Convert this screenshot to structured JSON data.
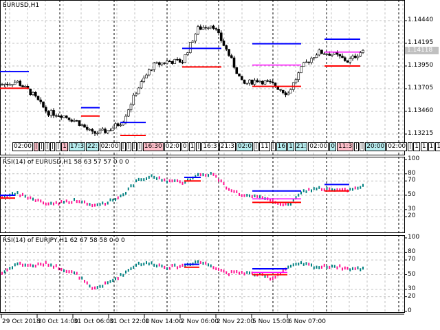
{
  "window": {
    "title": "EURUSD,H1"
  },
  "price_scale": {
    "ticks": [
      "1.14440",
      "1.14195",
      "1.13950",
      "1.13705",
      "1.13460",
      "1.13215"
    ],
    "tick_values": [
      1.1444,
      1.14195,
      1.1395,
      1.13705,
      1.1346,
      1.13215
    ],
    "current": "1.14118",
    "current_value": 1.14118
  },
  "time_labels": [
    {
      "t": "02:00",
      "k": ""
    },
    {
      "t": "|",
      "k": "p"
    },
    {
      "t": "|",
      "k": ""
    },
    {
      "t": "|",
      "k": ""
    },
    {
      "t": "|",
      "k": ""
    },
    {
      "t": "|",
      "k": ""
    },
    {
      "t": "1",
      "k": "p"
    },
    {
      "t": "17:3",
      "k": "c"
    },
    {
      "t": "22:",
      "k": "c"
    },
    {
      "t": "02:00",
      "k": ""
    },
    {
      "t": "|",
      "k": ""
    },
    {
      "t": "|",
      "k": ""
    },
    {
      "t": "|",
      "k": ""
    },
    {
      "t": "|",
      "k": ""
    },
    {
      "t": "16:30",
      "k": "p"
    },
    {
      "t": "02:0",
      "k": ""
    },
    {
      "t": "0",
      "k": ""
    },
    {
      "t": "1",
      "k": ""
    },
    {
      "t": "|",
      "k": ""
    },
    {
      "t": "16:3",
      "k": ""
    },
    {
      "t": "21:3",
      "k": ""
    },
    {
      "t": "02:0",
      "k": "c"
    },
    {
      "t": "|",
      "k": ""
    },
    {
      "t": "11",
      "k": ""
    },
    {
      "t": "|",
      "k": ""
    },
    {
      "t": "16",
      "k": "c"
    },
    {
      "t": "1",
      "k": "c"
    },
    {
      "t": "21:",
      "k": "c"
    },
    {
      "t": "02:00",
      "k": ""
    },
    {
      "t": "0",
      "k": "c"
    },
    {
      "t": "11:3",
      "k": "p"
    },
    {
      "t": "|",
      "k": ""
    },
    {
      "t": "|",
      "k": ""
    },
    {
      "t": "20:00",
      "k": "c"
    },
    {
      "t": "02:00",
      "k": ""
    },
    {
      "t": "|",
      "k": ""
    },
    {
      "t": "1",
      "k": ""
    },
    {
      "t": "1",
      "k": ""
    },
    {
      "t": "1",
      "k": ""
    },
    {
      "t": "1",
      "k": ""
    },
    {
      "t": "20",
      "k": ""
    },
    {
      "t": "2",
      "k": ""
    }
  ],
  "rsi_panels": [
    {
      "title": "RSI(14) of EURUSD,H1 58 63 57 57 0 0 0"
    },
    {
      "title": "RSI(14) of EURJPY,H1 62 67 58 58 0 0 0"
    }
  ],
  "rsi_scale": [
    "100",
    "80",
    "70",
    "50",
    "30",
    "20",
    "0"
  ],
  "date_axis": [
    "29 Oct 2018",
    "30 Oct 14:00",
    "31 Oct 06:00",
    "31 Oct 22:00",
    "1 Nov 14:00",
    "2 Nov 06:00",
    "2 Nov 22:00",
    "5 Nov 15:00",
    "6 Nov 07:00"
  ],
  "colors": {
    "up_rsi": "#008080",
    "down_rsi": "#ff1493",
    "high_level": "#0000ff",
    "low_level": "#ff0000",
    "mid_level": "#ff00ff"
  },
  "chart_data": {
    "type": "candlestick",
    "symbol": "EURUSD",
    "timeframe": "H1",
    "price_path": [
      1.1375,
      1.1378,
      1.1365,
      1.1345,
      1.1342,
      1.1335,
      1.1322,
      1.1325,
      1.1335,
      1.137,
      1.1395,
      1.14,
      1.14,
      1.1435,
      1.144,
      1.141,
      1.1375,
      1.138,
      1.1375,
      1.1365,
      1.1395,
      1.141,
      1.1408,
      1.14,
      1.1412
    ],
    "rsi_eurusd": [
      48,
      52,
      45,
      38,
      40,
      43,
      35,
      40,
      50,
      70,
      76,
      70,
      68,
      78,
      80,
      60,
      50,
      47,
      42,
      35,
      55,
      60,
      57,
      57,
      62
    ],
    "rsi_eurjpy": [
      52,
      65,
      62,
      65,
      58,
      50,
      30,
      38,
      50,
      65,
      65,
      60,
      62,
      68,
      62,
      52,
      53,
      50,
      45,
      60,
      65,
      60,
      62,
      58,
      58
    ],
    "price_levels": [
      {
        "high": 1.1389,
        "low": 1.1371
      },
      {
        "high": 1.135,
        "low": 1.1341
      },
      {
        "high": 1.1334,
        "low": 1.132
      },
      {
        "high": 1.1414,
        "low": 1.1394
      },
      {
        "high": 1.1419,
        "mid": 1.1396,
        "low": 1.1373
      },
      {
        "high": 1.1424,
        "mid": 1.141,
        "low": 1.1395
      }
    ],
    "rsi1_levels": [
      {
        "high": 50,
        "low": 46
      },
      {
        "high": 75,
        "low": 70
      },
      {
        "high": 56,
        "mid": 45,
        "low": 40
      },
      {
        "high": 65,
        "low": 56
      }
    ],
    "rsi2_levels": [
      {
        "high": 64,
        "low": 60
      },
      {
        "high": 58,
        "mid": 53,
        "low": 50
      }
    ]
  }
}
